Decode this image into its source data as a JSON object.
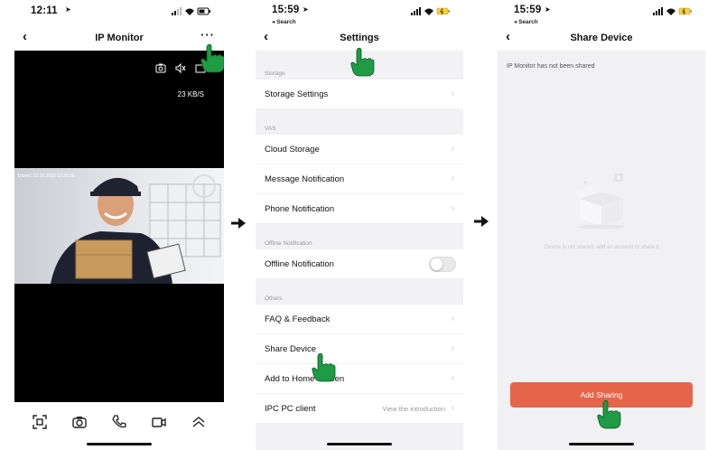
{
  "phone1": {
    "time": "12:11",
    "title": "IP Monitor",
    "more": "···",
    "speed": "23 KB/S",
    "osd": "Drzwi1 22.10.2022 12:25:36",
    "icons": [
      "camera-icon",
      "mute-icon",
      "record-icon"
    ],
    "bottom_icons": [
      "scan-icon",
      "camera-icon",
      "phone-icon",
      "video-icon",
      "chevron-up-icon"
    ]
  },
  "phone2": {
    "time": "15:59",
    "back_label": "◂ Search",
    "title": "Settings",
    "sections": [
      {
        "header": "Storage",
        "rows": [
          {
            "label": "Storage Settings"
          }
        ]
      },
      {
        "header": "VAS",
        "rows": [
          {
            "label": "Cloud Storage"
          },
          {
            "label": "Message Notification"
          },
          {
            "label": "Phone Notification"
          }
        ]
      },
      {
        "header": "Offline Notification",
        "rows": [
          {
            "label": "Offline Notification"
          }
        ]
      },
      {
        "header": "Others",
        "rows": [
          {
            "label": "FAQ & Feedback"
          },
          {
            "label": "Share Device"
          },
          {
            "label": "Add to Home Screen"
          },
          {
            "label": "IPC PC client",
            "hint": "View the introduction"
          }
        ]
      }
    ]
  },
  "phone3": {
    "time": "15:59",
    "back_label": "◂ Search",
    "title": "Share Device",
    "status": "IP Monitor  has not been shared",
    "empty_text": "Device is not shared, add an account to share it",
    "button": "Add Sharing"
  },
  "colors": {
    "accent": "#e4654a",
    "hand": "#1e9b44"
  }
}
